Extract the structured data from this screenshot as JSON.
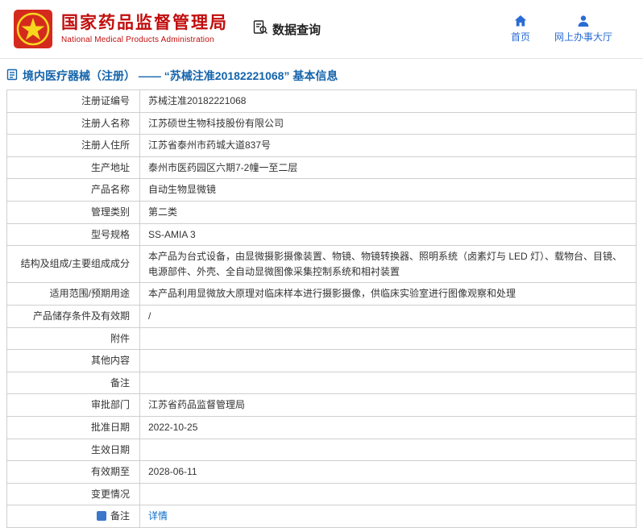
{
  "header": {
    "agency_cn": "国家药品监督管理局",
    "agency_en": "National Medical Products Administration",
    "nav_query": "数据查询",
    "nav_home": "首页",
    "nav_hall": "网上办事大厅"
  },
  "section": {
    "title": "境内医疗器械（注册） —— “苏械注准20182221068” 基本信息"
  },
  "colors": {
    "brand_red": "#c10d0d",
    "link_blue": "#2a6cd5",
    "section_blue": "#1464ab",
    "table_border": "#cfcfcf"
  },
  "table": {
    "rows": [
      {
        "label": "注册证编号",
        "value": "苏械注准20182221068"
      },
      {
        "label": "注册人名称",
        "value": "江苏硕世生物科技股份有限公司"
      },
      {
        "label": "注册人住所",
        "value": "江苏省泰州市药城大道837号"
      },
      {
        "label": "生产地址",
        "value": "泰州市医药园区六期7-2幢一至二层"
      },
      {
        "label": "产品名称",
        "value": "自动生物显微镜"
      },
      {
        "label": "管理类别",
        "value": "第二类"
      },
      {
        "label": "型号规格",
        "value": "SS-AMIA 3"
      },
      {
        "label": "结构及组成/主要组成成分",
        "value": "本产品为台式设备，由显微摄影摄像装置、物镜、物镜转换器、照明系统（卤素灯与 LED 灯）、载物台、目镜、电源部件、外壳、全自动显微图像采集控制系统和相衬装置"
      },
      {
        "label": "适用范围/预期用途",
        "value": "本产品利用显微放大原理对临床样本进行摄影摄像，供临床实验室进行图像观察和处理"
      },
      {
        "label": "产品储存条件及有效期",
        "value": "/"
      },
      {
        "label": "附件",
        "value": ""
      },
      {
        "label": "其他内容",
        "value": ""
      },
      {
        "label": "备注",
        "value": ""
      },
      {
        "label": "审批部门",
        "value": "江苏省药品监督管理局"
      },
      {
        "label": "批准日期",
        "value": "2022-10-25"
      },
      {
        "label": "生效日期",
        "value": ""
      },
      {
        "label": "有效期至",
        "value": "2028-06-11"
      },
      {
        "label": "变更情况",
        "value": ""
      },
      {
        "label": "备注",
        "value": "详情",
        "link": true,
        "icon": true
      }
    ]
  }
}
